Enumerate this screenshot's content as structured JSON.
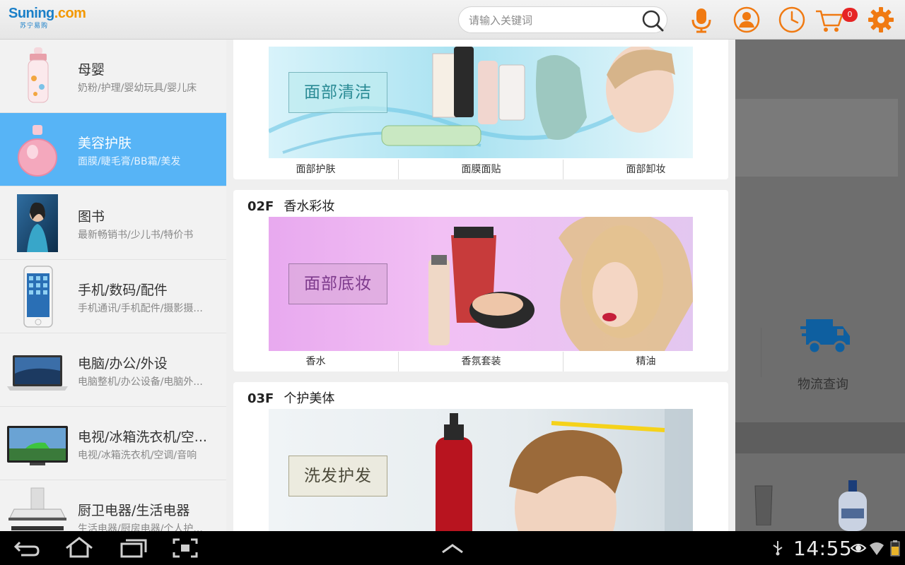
{
  "header": {
    "logo_text": "Suning",
    "logo_domain": ".com",
    "logo_sub": "苏宁易购",
    "search_placeholder": "请输入关键词",
    "cart_count": "0",
    "icons": [
      "search-icon",
      "microphone-icon",
      "user-icon",
      "history-clock-icon",
      "cart-icon",
      "settings-gear-icon"
    ]
  },
  "sidebar": {
    "items": [
      {
        "title": "母婴",
        "desc": "奶粉/护理/婴幼玩具/婴儿床",
        "active": false
      },
      {
        "title": "美容护肤",
        "desc": "面膜/睫毛膏/BB霜/美发",
        "active": true
      },
      {
        "title": "图书",
        "desc": "最新畅销书/少儿书/特价书",
        "active": false
      },
      {
        "title": "手机/数码/配件",
        "desc": "手机通讯/手机配件/摄影摄...",
        "active": false
      },
      {
        "title": "电脑/办公/外设",
        "desc": "电脑整机/办公设备/电脑外...",
        "active": false
      },
      {
        "title": "电视/冰箱洗衣机/空...",
        "desc": "电视/冰箱洗衣机/空调/音响",
        "active": false
      },
      {
        "title": "厨卫电器/生活电器",
        "desc": "生活电器/厨房电器/个人护...",
        "active": false
      }
    ]
  },
  "floors": [
    {
      "num": "",
      "name": "",
      "banner_label": "面部清洁",
      "subs": [
        "面部护肤",
        "面膜面贴",
        "面部卸妆"
      ]
    },
    {
      "num": "02F",
      "name": "香水彩妆",
      "banner_label": "面部底妆",
      "subs": [
        "香水",
        "香氛套装",
        "精油"
      ]
    },
    {
      "num": "03F",
      "name": "个护美体",
      "banner_label": "洗发护发",
      "subs": []
    }
  ],
  "overlay": {
    "logistics_label": "物流查询"
  },
  "system_bar": {
    "clock": "14:55"
  },
  "colors": {
    "active_blue": "#57b4f6",
    "brand_blue": "#1a7fc8",
    "icon_orange": "#f07a12",
    "badge_red": "#e62424",
    "overlay_gray": "#6e6e6e"
  }
}
